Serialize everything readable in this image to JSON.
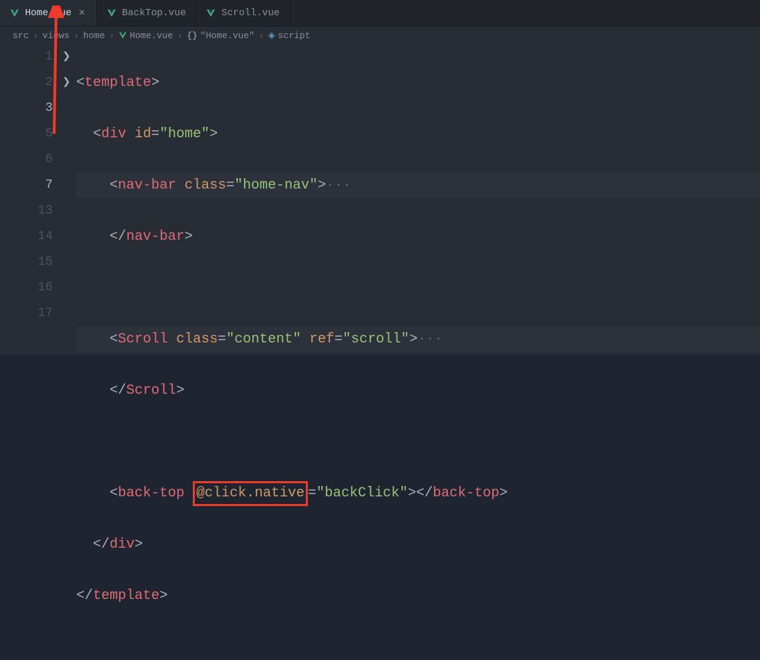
{
  "tabs": [
    {
      "label": "Home.vue",
      "active": true,
      "closeable": true
    },
    {
      "label": "BackTop.vue",
      "active": false
    },
    {
      "label": "Scroll.vue",
      "active": false
    }
  ],
  "breadcrumb": {
    "parts": [
      "src",
      "views",
      "home",
      "Home.vue",
      "\"Home.vue\"",
      "script"
    ],
    "braces": "{}"
  },
  "lines": {
    "n1": "1",
    "n2": "2",
    "n3": "3",
    "n5": "5",
    "n6": "6",
    "n7": "7",
    "n13": "13",
    "n14": "14",
    "n15": "15",
    "n16": "16",
    "n17": "17"
  },
  "code": {
    "template": "template",
    "div": "div",
    "id": "id",
    "home": "\"home\"",
    "navbar": "nav-bar",
    "class": "class",
    "homenav": "\"home-nav\"",
    "scroll": "Scroll",
    "content": "\"content\"",
    "ref": "ref",
    "scrollval": "\"scroll\"",
    "backtop": "back-top",
    "clicknative": "@click.native",
    "backclick": "\"backClick\"",
    "dots": "···"
  }
}
